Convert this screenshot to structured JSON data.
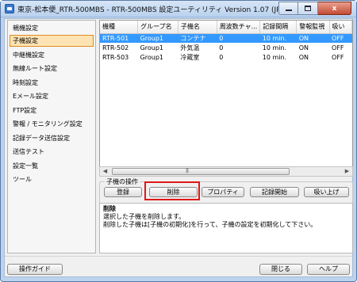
{
  "window": {
    "title": "東京-松本便_RTR-500MBS - RTR-500MBS 設定ユーティリティ Version 1.07 (JP)",
    "caption_close": "x"
  },
  "sidebar": {
    "items": [
      {
        "label": "親機設定"
      },
      {
        "label": "子機設定",
        "selected": true
      },
      {
        "label": "中継機設定"
      },
      {
        "label": "無線ルート設定"
      },
      {
        "label": "時刻設定"
      },
      {
        "label": "Eメール設定"
      },
      {
        "label": "FTP設定"
      },
      {
        "label": "警報 / モニタリング設定"
      },
      {
        "label": "記録データ送信設定"
      },
      {
        "label": "送信テスト"
      },
      {
        "label": "設定一覧"
      },
      {
        "label": "ツール"
      }
    ]
  },
  "table": {
    "headers": [
      "機種",
      "グループ名",
      "子機名",
      "周波数チャ...",
      "記録間隔",
      "警報監視",
      "吸い"
    ],
    "rows": [
      {
        "cells": [
          "RTR-501",
          "Group1",
          "コンテナ",
          "0",
          "10 min.",
          "ON",
          "OFF"
        ],
        "selected": true
      },
      {
        "cells": [
          "RTR-502",
          "Group1",
          "外気温",
          "0",
          "10 min.",
          "ON",
          "OFF"
        ]
      },
      {
        "cells": [
          "RTR-503",
          "Group1",
          "冷蔵室",
          "0",
          "10 min.",
          "ON",
          "OFF"
        ]
      }
    ]
  },
  "operations": {
    "label": "子機の操作",
    "register": "登録",
    "delete": "削除",
    "properties": "プロパティ",
    "start_recording": "記録開始",
    "download": "吸い上げ"
  },
  "description": {
    "heading": "削除",
    "line1": "選択した子機を削除します。",
    "line2": "削除した子機は[子機の初期化]を行って、子機の設定を初期化して下さい。"
  },
  "footer": {
    "guide": "操作ガイド",
    "close": "閉じる",
    "help": "ヘルプ"
  }
}
